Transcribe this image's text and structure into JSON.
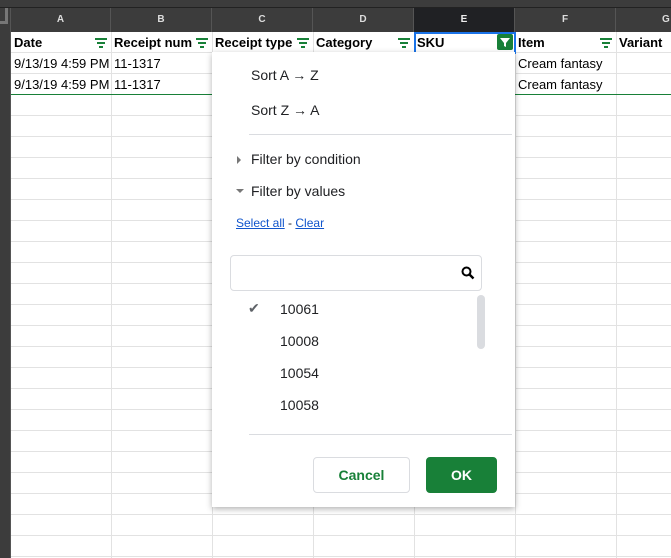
{
  "columns": [
    "A",
    "B",
    "C",
    "D",
    "E",
    "F",
    "G"
  ],
  "headers": [
    "Date",
    "Receipt num",
    "Receipt type",
    "Category",
    "SKU",
    "Item",
    "Variant"
  ],
  "rows": [
    [
      "9/13/19 4:59 PM",
      "11-1317",
      "",
      "",
      "",
      "Cream fantasy",
      ""
    ],
    [
      "9/13/19 4:59 PM",
      "11-1317",
      "",
      "",
      "",
      "Cream fantasy",
      ""
    ]
  ],
  "menu": {
    "sort_az": "Sort A → Z",
    "sort_za": "Sort Z → A",
    "filter_condition": "Filter by condition",
    "filter_values": "Filter by values",
    "select_all": "Select all",
    "dash": "-",
    "clear": "Clear",
    "search_value": "",
    "values": [
      {
        "label": "10061",
        "checked": true
      },
      {
        "label": "10008",
        "checked": false
      },
      {
        "label": "10054",
        "checked": false
      },
      {
        "label": "10058",
        "checked": false
      }
    ],
    "cancel": "Cancel",
    "ok": "OK"
  },
  "colors": {
    "accent": "#188038",
    "link": "#1155cc"
  }
}
